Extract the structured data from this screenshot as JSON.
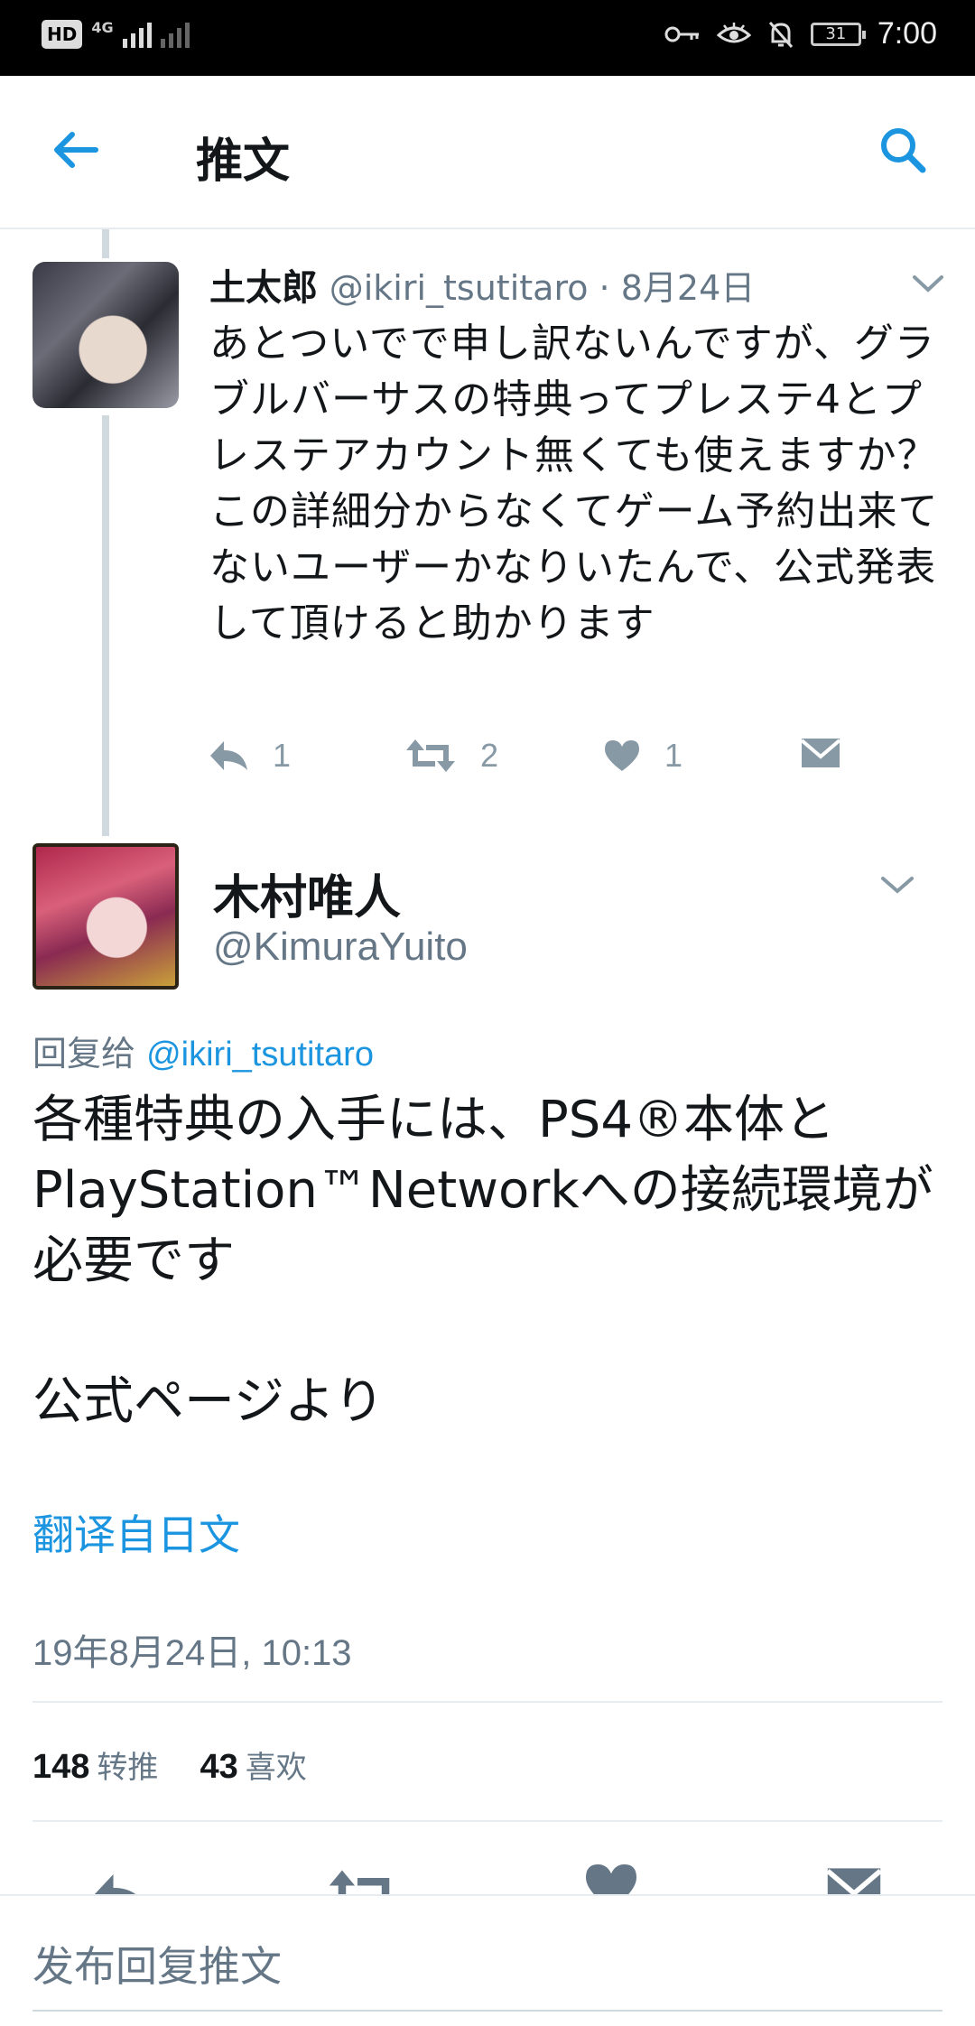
{
  "status_bar": {
    "hd": "HD",
    "network": "4G",
    "battery": "31",
    "time": "7:00"
  },
  "header": {
    "title": "推文"
  },
  "tweet1": {
    "display_name": "土太郎",
    "meta": "@ikiri_tsutitaro · 8月24日",
    "text": "あとついでで申し訳ないんですが、グラブルバーサスの特典ってプレステ4とプレステアカウント無くても使えますか？\nこの詳細分からなくてゲーム予約出来てないユーザーかなりいたんで、公式発表して頂けると助かります",
    "reply_count": "1",
    "retweet_count": "2",
    "like_count": "1"
  },
  "tweet2": {
    "display_name": "木村唯人",
    "handle": "@KimuraYuito",
    "reply_prefix": "回复给 ",
    "reply_handle": "@ikiri_tsutitaro",
    "text": "各種特典の入手には、PS4®本体とPlayStation™Networkへの接続環境が必要です\n\n公式ページより",
    "translate_label": "翻译自日文",
    "timestamp": "19年8月24日, 10:13",
    "retweets": "148",
    "retweets_label": "转推",
    "likes": "43",
    "likes_label": "喜欢"
  },
  "compose": {
    "placeholder": "发布回复推文"
  },
  "colors": {
    "accent": "#1b95e0",
    "secondary_text": "#657786",
    "icon_gray": "#8899a6"
  }
}
